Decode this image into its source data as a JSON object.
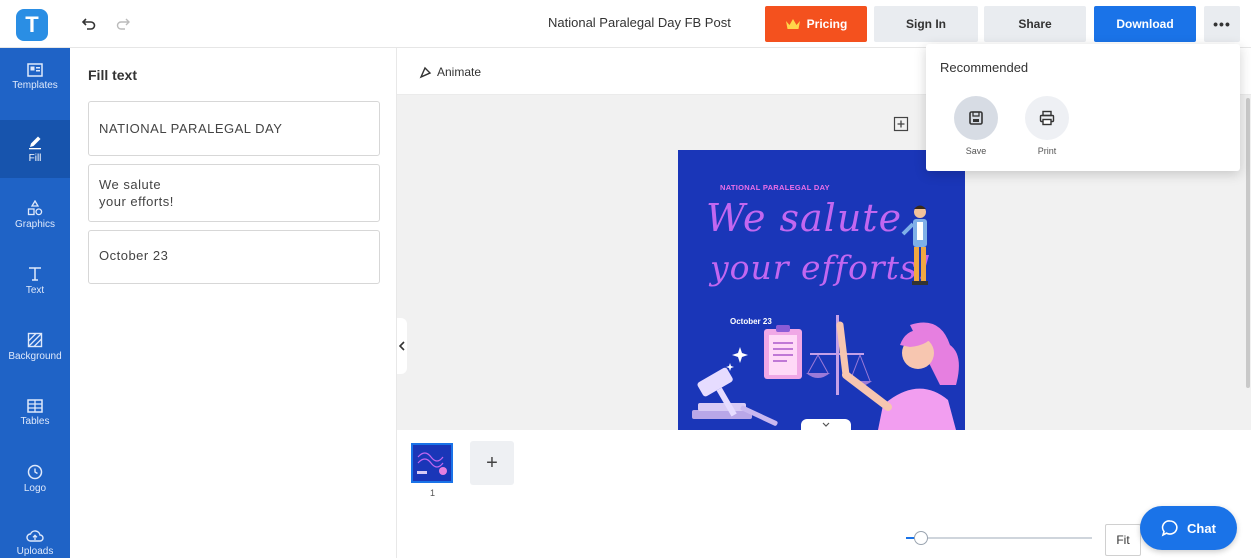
{
  "topbar": {
    "logo_letter": "T",
    "doc_title": "National Paralegal Day FB Post",
    "pricing_label": "Pricing",
    "signin_label": "Sign In",
    "share_label": "Share",
    "download_label": "Download",
    "more_label": "•••"
  },
  "rail": {
    "items": [
      {
        "label": "Templates"
      },
      {
        "label": "Fill"
      },
      {
        "label": "Graphics"
      },
      {
        "label": "Text"
      },
      {
        "label": "Background"
      },
      {
        "label": "Tables"
      },
      {
        "label": "Logo"
      },
      {
        "label": "Uploads"
      }
    ]
  },
  "panel": {
    "title": "Fill text",
    "fields": [
      {
        "value": "NATIONAL PARALEGAL DAY"
      },
      {
        "value": "We salute\nyour efforts!"
      },
      {
        "value": "October 23"
      }
    ]
  },
  "canvas": {
    "animate_label": "Animate",
    "design": {
      "subtitle": "NATIONAL PARALEGAL DAY",
      "script_line1": "We salute",
      "script_line2": "your efforts!",
      "date": "October 23"
    }
  },
  "pages": {
    "thumb_number": "1",
    "add_label": "+"
  },
  "zoom": {
    "fit_label": "Fit",
    "level_fraction": 0.08
  },
  "chat": {
    "label": "Chat"
  },
  "dropdown": {
    "title": "Recommended",
    "items": [
      {
        "label": "Save",
        "icon": "save-icon"
      },
      {
        "label": "Print",
        "icon": "print-icon"
      }
    ]
  },
  "colors": {
    "brand": "#1f63c6",
    "pricing": "#f4511e",
    "download": "#1a73e8",
    "design_bg": "#1a36b8",
    "script_text": "#c267f0"
  }
}
